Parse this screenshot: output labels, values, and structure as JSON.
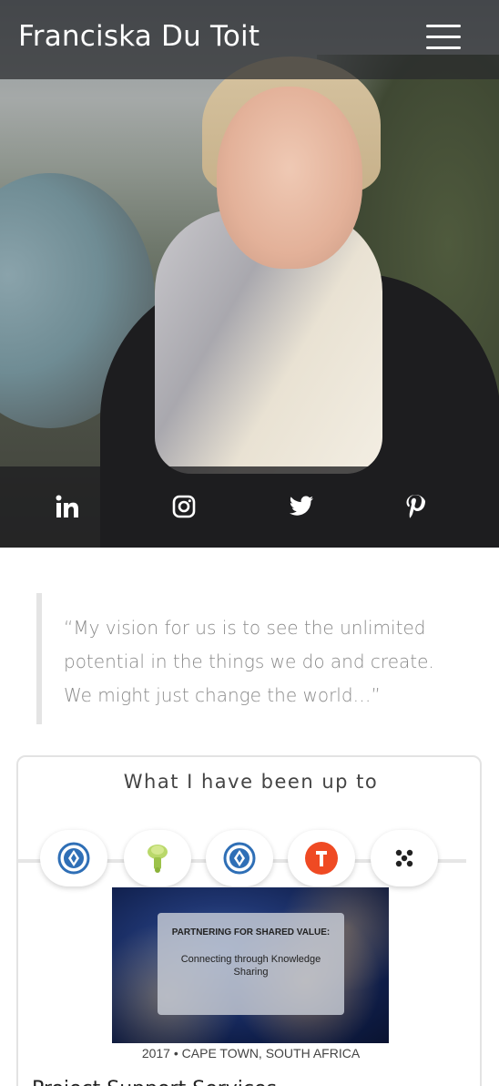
{
  "header": {
    "site_title": "Franciska Du Toit",
    "menu_icon": "hamburger-menu-icon"
  },
  "hero": {
    "image": "profile-photo",
    "social": [
      {
        "name": "linkedin",
        "icon": "linkedin-icon"
      },
      {
        "name": "instagram",
        "icon": "instagram-icon"
      },
      {
        "name": "twitter",
        "icon": "twitter-icon"
      },
      {
        "name": "pinterest",
        "icon": "pinterest-icon"
      }
    ]
  },
  "quote": {
    "line1": "“My vision for us is to see the unlimited",
    "line2": "potential in the things we do and create.",
    "line3": "We might just change the world…”"
  },
  "activity": {
    "title": "What I have been up to",
    "timeline": [
      {
        "icon": "organization-logo-blue-icon"
      },
      {
        "icon": "baobab-tree-logo-icon"
      },
      {
        "icon": "organization-logo-blue-icon"
      },
      {
        "icon": "orange-circle-logo-icon"
      },
      {
        "icon": "dots-logo-icon"
      }
    ],
    "slide": {
      "heading": "PARTNERING FOR SHARED VALUE:",
      "subheading": "Connecting through Knowledge Sharing"
    },
    "caption": "2017 • CAPE TOWN, SOUTH AFRICA",
    "next_heading": "Project Support Services"
  },
  "colors": {
    "quote_text": "#8a8a8a",
    "quote_border": "#e4e4e4",
    "card_border": "#e3e3e3",
    "logo_blue": "#2f6fb6",
    "logo_orange": "#ef4a23"
  }
}
